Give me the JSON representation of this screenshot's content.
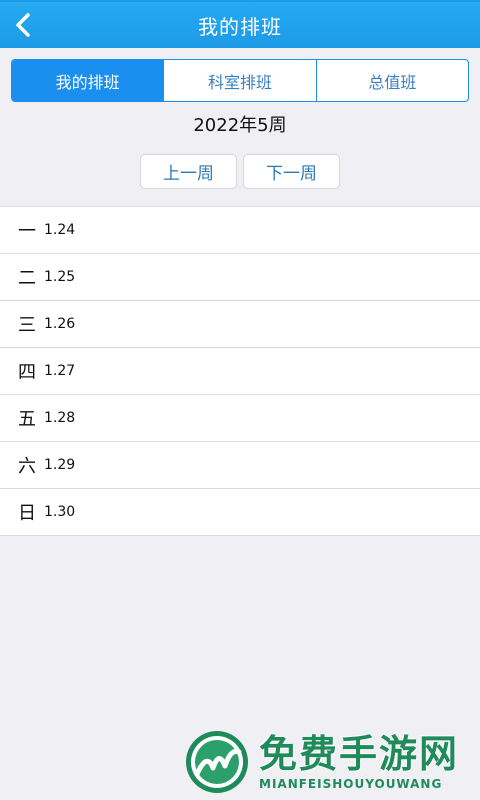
{
  "header": {
    "title": "我的排班",
    "back_icon": "chevron-left-icon"
  },
  "tabs": [
    {
      "label": "我的排班",
      "active": true
    },
    {
      "label": "科室排班",
      "active": false
    },
    {
      "label": "总值班",
      "active": false
    }
  ],
  "week": {
    "label": "2022年5周",
    "prev_label": "上一周",
    "next_label": "下一周"
  },
  "days": [
    {
      "name": "一",
      "date": "1.24"
    },
    {
      "name": "二",
      "date": "1.25"
    },
    {
      "name": "三",
      "date": "1.26"
    },
    {
      "name": "四",
      "date": "1.27"
    },
    {
      "name": "五",
      "date": "1.28"
    },
    {
      "name": "六",
      "date": "1.29"
    },
    {
      "name": "日",
      "date": "1.30"
    }
  ],
  "watermark": {
    "cn": "免费手游网",
    "en": "MIANFEISHOUYOUWANG"
  },
  "colors": {
    "header": "#1c9ae6",
    "accent": "#1a8ff0",
    "background": "#efeff4",
    "watermark": "#1f8a5a"
  }
}
